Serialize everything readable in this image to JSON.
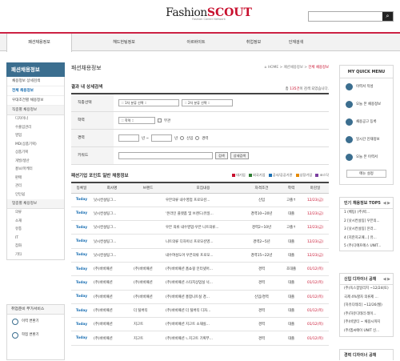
{
  "header": {
    "logo_part1": "Fashion",
    "logo_part2": "SCOUT",
    "logo_sub": "Fashion Career Network",
    "search_placeholder": "",
    "search_icon": "search-icon"
  },
  "gnb": {
    "tabs": [
      {
        "label": "패션채용정보",
        "active": true
      },
      {
        "label": "헤드헌팅정보",
        "active": false
      },
      {
        "label": "아르바이트",
        "active": false
      },
      {
        "label": "취업정보",
        "active": false
      },
      {
        "label": "인재검색",
        "active": false
      }
    ]
  },
  "lnb": {
    "title": "패션채용정보",
    "items": [
      {
        "label": "채용정보 상세검색",
        "active": false
      },
      {
        "label": "전체 채용정보",
        "active": true
      },
      {
        "label": "우대조건별 채용정보",
        "active": false
      },
      {
        "label": "직종별 채용정보",
        "active": false
      }
    ],
    "subs1": [
      "디자이너",
      "수출입관리",
      "영업",
      "MD(상품기획)",
      "상품기획",
      "개발/생산",
      "홍보/마케터",
      "판매",
      "관리",
      "인턴쉽"
    ],
    "group2": "업종별 채용정보",
    "subs2": [
      "의류",
      "소재",
      "유통",
      "IT",
      "잡화",
      "기타"
    ]
  },
  "services": {
    "title": "취업준비 부가서비스",
    "items": [
      "이력 변환기",
      "학점 변환기"
    ]
  },
  "main": {
    "page_title": "패션채용정보",
    "breadcrumb": {
      "home": "HOME",
      "sep1": "패션채용정보",
      "current": "전체 채용정보"
    },
    "result_title": "결과 내 상세검색",
    "count_prefix": "총 ",
    "count_value": "135건",
    "count_suffix": "이 검색 되었습니다.",
    "form": {
      "job_label": "직종선택",
      "job_select1": ":: 1차 분류 선택 ::",
      "job_select2": ":: 2차 분류 선택 ::",
      "edu_label": "학력",
      "edu_select": ":: 학력 ::",
      "edu_check": "무관",
      "exp_label": "경력",
      "exp_unit1": "년 ~",
      "exp_unit2": "년",
      "exp_radio1": "신입",
      "exp_radio2": "경력",
      "kw_label": "키워드",
      "kw_btn1": "검색",
      "kw_btn2": "상세검색"
    },
    "list_title": "패션기업 포인트 일반 채용정보",
    "legend": [
      "대기업",
      "외국기업",
      "공사/공공기관",
      "상장기업",
      "코스닥"
    ],
    "legend_colors": [
      "#c8102e",
      "#2e7d32",
      "#1a6fb3",
      "#e58a00",
      "#7b3fa0"
    ],
    "columns": [
      "등록일",
      "회사명",
      "브랜드",
      "모집내용",
      "자격조건",
      "학력",
      "마감일"
    ],
    "rows": [
      [
        "Today",
        "낫시컨설팅그...",
        "",
        "우븐의류 내수영업 프로모션...",
        "신입",
        "고졸↑",
        "12/23(금)"
      ],
      [
        "Today",
        "낫시컨설팅그...",
        "",
        "'온라인 플랫폼 및 브랜드(유일...",
        "경력10~20년",
        "대졸",
        "12/23(금)"
      ],
      [
        "Today",
        "낫시컨설팅그...",
        "",
        "우븐 의류 내수영업-우븐 니트의류...",
        "경력2~10년",
        "고졸↑",
        "12/23(금)"
      ],
      [
        "Today",
        "낫시컨설팅그...",
        "",
        "니트의류 디자이너 프로모션영...",
        "경력2~5년",
        "대졸",
        "12/23(금)"
      ],
      [
        "Today",
        "낫시컨설팅그...",
        "",
        "내수여성도어 우븐의류 프로모...",
        "경력15~22년",
        "대졸",
        "12/23(금)"
      ],
      [
        "Today",
        "(주)바바패션",
        "(주)바바패션",
        "(주)바바패션 홈쇼핑 인터넷어...",
        "경력",
        "초대졸",
        "01/12(목)"
      ],
      [
        "Today",
        "(주)바바패션",
        "(주)바바패션",
        "(주)바바패션 스타치상업실 넉...",
        "경력",
        "대졸",
        "01/12(목)"
      ],
      [
        "Today",
        "(주)바바패션",
        "(주)바바패션",
        "(주)바바패션 홍합니트실 경...",
        "신입/경력",
        "대졸",
        "01/12(목)"
      ],
      [
        "Today",
        "(주)바바패션",
        "더 틸버티",
        "(주)바바패션 더 틸버티 디자...",
        "경력",
        "대졸",
        "01/12(목)"
      ],
      [
        "Today",
        "(주)바바패션",
        "지고트",
        "(주)바바패션 지고트 소재실...",
        "경력",
        "대졸",
        "01/12(목)"
      ],
      [
        "Today",
        "(주)바바패션",
        "지고트",
        "(주)바바패션 ㄴ지고트 기획부...",
        "경력",
        "대졸",
        "01/12(목)"
      ]
    ]
  },
  "quick": {
    "title": "MY QUICK MENU",
    "items": [
      "이력서 작성",
      "오늘 본 채용정보",
      "채용공고 등록",
      "일시간 인재정보",
      "오늘 본 이력서"
    ],
    "setting": "메뉴 설정"
  },
  "top5": {
    "title": "인기 채용정보 TOP5",
    "nav": "◀ ▶",
    "items": [
      "1 (베팅) (주)박...",
      "2 [낫시컨설팅] 우븐의...",
      "3 [낫시컨설팅] 온라...",
      "4 [지란지교패...] 유...",
      "5 (주)디에프에스 UNIT..."
    ]
  },
  "designer": {
    "title": "신입 디자이너 공채",
    "nav": "◀ ▶",
    "items": [
      "(주)옥스팜일리치 ~12/24(토)",
      "국제 4%할자 의류제 ...",
      "[하유디테리] ~12/26(월)",
      "(주)하유디테리 레이...",
      "[주)비알티 ~ 채용시까지",
      "(주)엠씨에이 UNIT 신..."
    ]
  },
  "career": {
    "title": "경력 디자이너 공채",
    "nav": ""
  }
}
